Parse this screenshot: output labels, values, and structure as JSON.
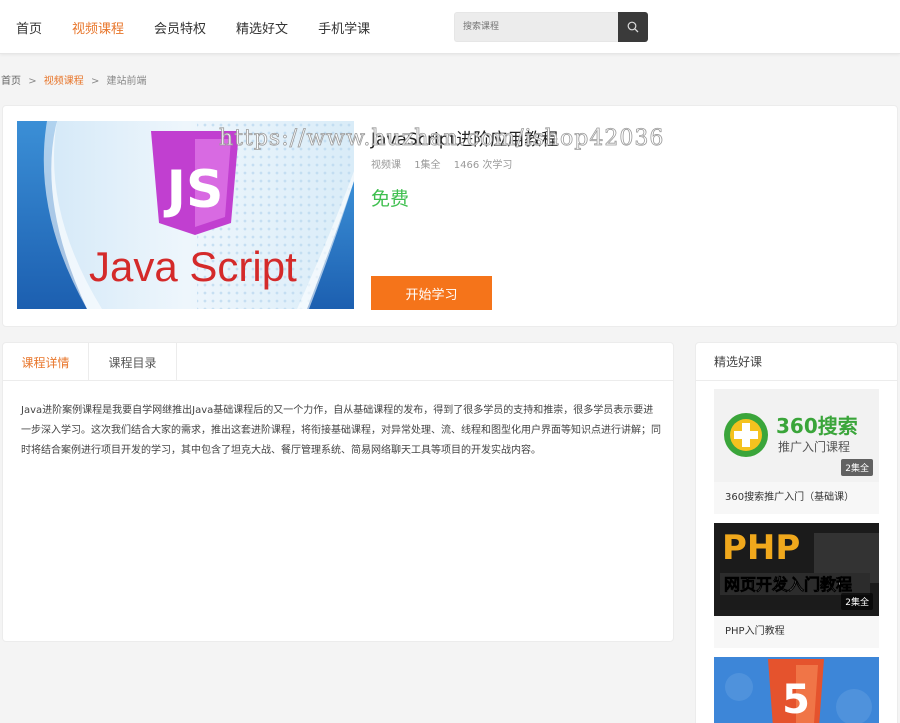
{
  "nav": {
    "items": [
      {
        "label": "首页",
        "active": false
      },
      {
        "label": "视频课程",
        "active": true
      },
      {
        "label": "会员特权",
        "active": false
      },
      {
        "label": "精选好文",
        "active": false
      },
      {
        "label": "手机学课",
        "active": false
      }
    ]
  },
  "search": {
    "placeholder": "搜索课程",
    "icon": "search-icon"
  },
  "breadcrumb": {
    "home": "首页",
    "sep1": ">",
    "category": "视频课程",
    "sep2": ">",
    "current": "建站前端"
  },
  "course": {
    "cover_text": "Java Script",
    "cover_logo": "JS",
    "title": "JavaScript进阶应用教程",
    "type": "视频课",
    "episodes": "1集全",
    "learners": "1466 次学习",
    "price": "免费",
    "start_button": "开始学习"
  },
  "watermark": "https://www.huzhan.com/ishop42036",
  "detail": {
    "tabs": [
      {
        "label": "课程详情",
        "active": true
      },
      {
        "label": "课程目录",
        "active": false
      }
    ],
    "description": "Java进阶案例课程是我要自学网继推出Java基础课程后的又一个力作，自从基础课程的发布，得到了很多学员的支持和推崇，很多学员表示要进一步深入学习。这次我们结合大家的需求，推出这套进阶课程，将衔接基础课程，对异常处理、流、线程和图型化用户界面等知识点进行讲解；同时将结合案例进行项目开发的学习，其中包含了坦克大战、餐厅管理系统、简易网络聊天工具等项目的开发实战内容。"
  },
  "sidebar": {
    "title": "精选好课",
    "items": [
      {
        "name": "360搜索推广入门（基础课）",
        "badge": "2集全",
        "thumb_line1": "360搜索",
        "thumb_line2": "推广入门课程"
      },
      {
        "name": "PHP入门教程",
        "badge": "2集全",
        "thumb_line1": "PHP",
        "thumb_line2": "网页开发入门教程"
      },
      {
        "name": "",
        "badge": "",
        "thumb_line1": "5",
        "thumb_line2": ""
      }
    ]
  },
  "colors": {
    "accent": "#e8762b",
    "price": "#3fbf4f",
    "button": "#f5741a"
  }
}
